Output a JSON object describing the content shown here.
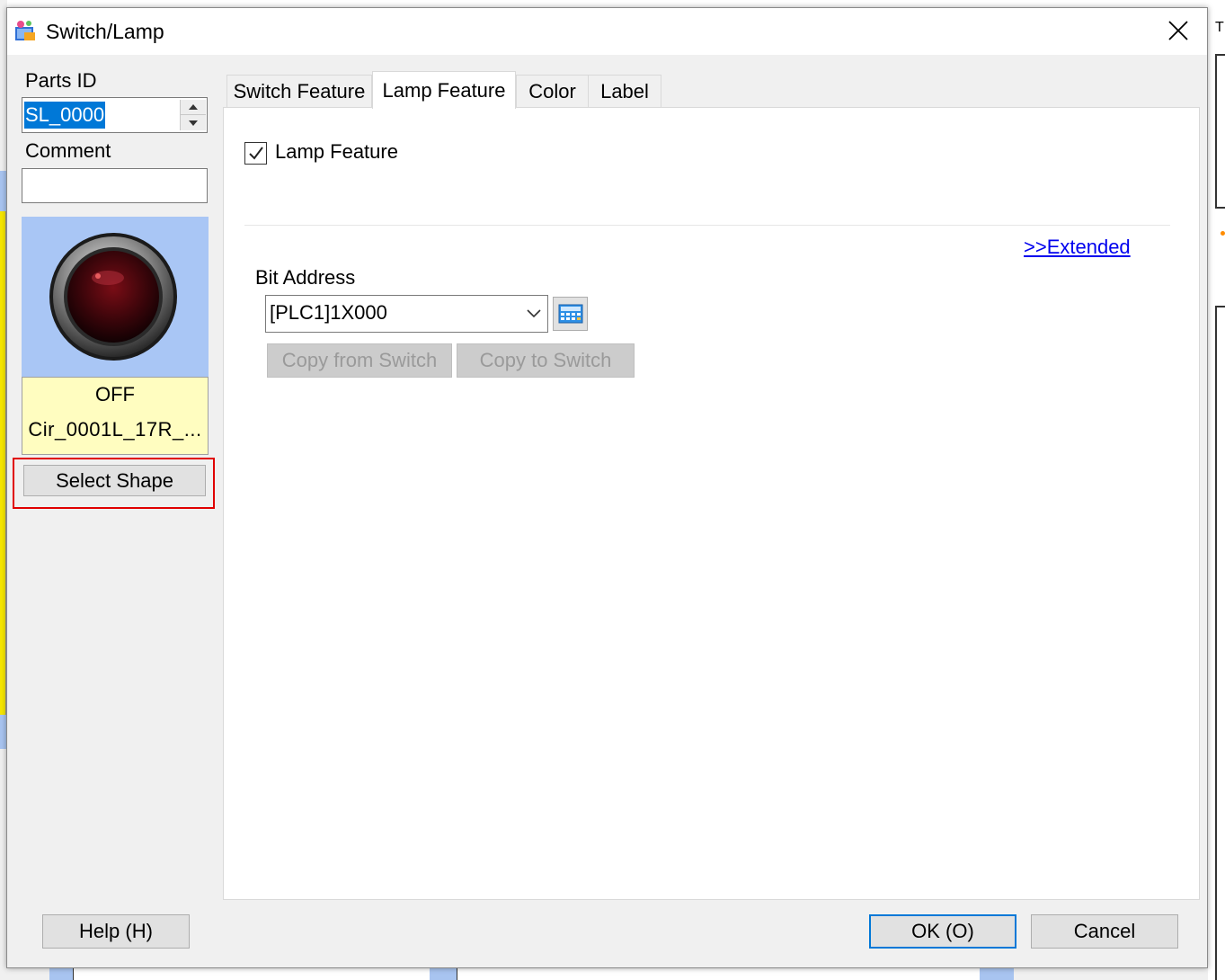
{
  "window": {
    "title": "Switch/Lamp"
  },
  "left": {
    "parts_id_label": "Parts ID",
    "parts_id_value": "SL_0000",
    "comment_label": "Comment",
    "comment_value": "",
    "preview_state": "OFF",
    "preview_shape": "Cir_0001L_17R_...",
    "select_shape_label": "Select Shape"
  },
  "tabs": [
    {
      "label": "Switch Feature",
      "active": false
    },
    {
      "label": "Lamp Feature",
      "active": true
    },
    {
      "label": "Color",
      "active": false
    },
    {
      "label": "Label",
      "active": false
    }
  ],
  "lamp": {
    "checkbox_label": "Lamp Feature",
    "checked": true,
    "extended_link": ">>Extended",
    "bit_address_label": "Bit Address",
    "bit_address_value": "[PLC1]1X000",
    "copy_from_label": "Copy from Switch",
    "copy_to_label": "Copy to Switch"
  },
  "footer": {
    "help_label": "Help (H)",
    "ok_label": "OK (O)",
    "cancel_label": "Cancel"
  },
  "background": {
    "right_fragment": "T"
  },
  "colors": {
    "highlight": "#e00000",
    "accent": "#0078d7",
    "preview_bg": "#a9c6f5",
    "caption_bg": "#fffdc0"
  }
}
